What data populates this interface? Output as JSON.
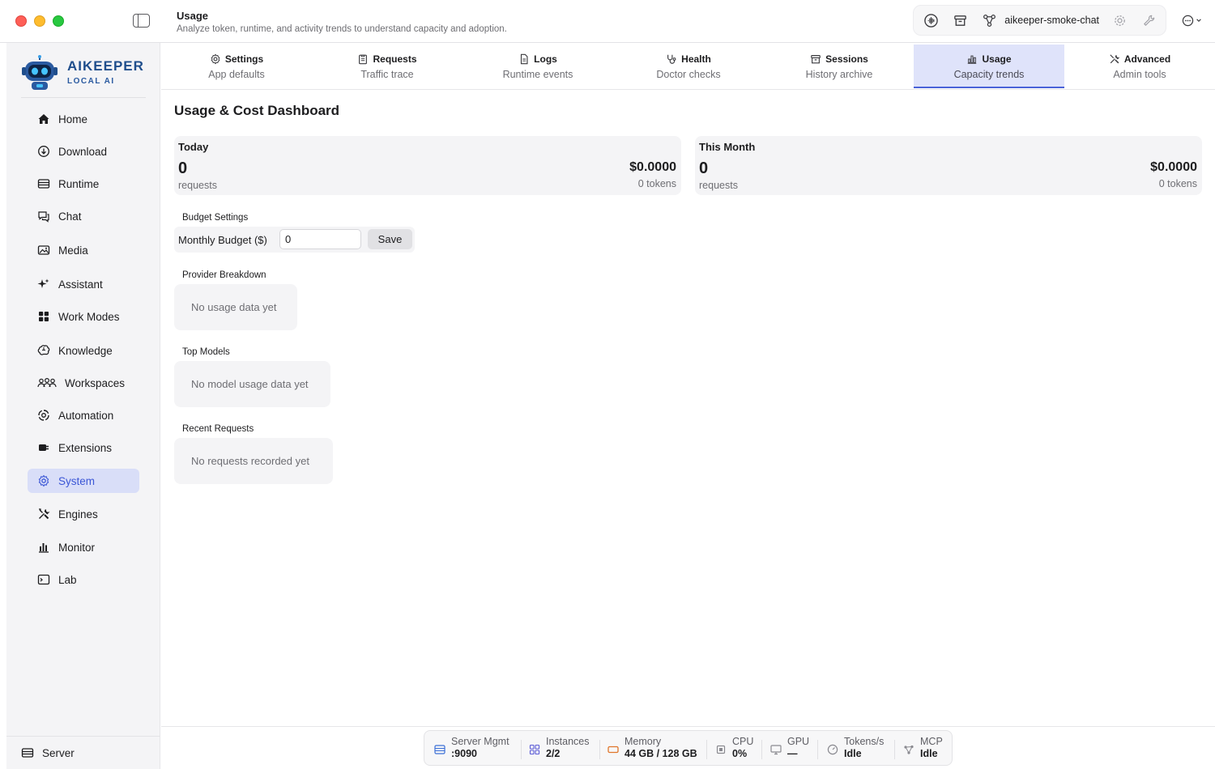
{
  "header": {
    "title": "Usage",
    "subtitle": "Analyze token, runtime, and activity trends to understand capacity and adoption.",
    "project_name": "aikeeper-smoke-chat"
  },
  "brand": {
    "name": "AIKEEPER",
    "tagline": "LOCAL AI"
  },
  "sidebar": {
    "items": [
      {
        "label": "Home",
        "icon": "home-icon"
      },
      {
        "label": "Download",
        "icon": "download-icon"
      },
      {
        "label": "Runtime",
        "icon": "runtime-icon"
      },
      {
        "label": "Chat",
        "icon": "chat-icon"
      },
      {
        "label": "Media",
        "icon": "media-icon"
      },
      {
        "label": "Assistant",
        "icon": "sparkle-icon"
      },
      {
        "label": "Work Modes",
        "icon": "grid-icon"
      },
      {
        "label": "Knowledge",
        "icon": "brain-icon"
      },
      {
        "label": "Workspaces",
        "icon": "people-icon"
      },
      {
        "label": "Automation",
        "icon": "automation-icon"
      },
      {
        "label": "Extensions",
        "icon": "plug-icon"
      },
      {
        "label": "System",
        "icon": "gear-icon",
        "active": true
      },
      {
        "label": "Engines",
        "icon": "tools-icon"
      },
      {
        "label": "Monitor",
        "icon": "bar-chart-icon"
      },
      {
        "label": "Lab",
        "icon": "terminal-icon"
      }
    ],
    "bottom_label": "Server"
  },
  "tabs": [
    {
      "label": "Settings",
      "sub": "App defaults",
      "icon": "gear-icon"
    },
    {
      "label": "Requests",
      "sub": "Traffic trace",
      "icon": "clipboard-icon"
    },
    {
      "label": "Logs",
      "sub": "Runtime events",
      "icon": "document-icon"
    },
    {
      "label": "Health",
      "sub": "Doctor checks",
      "icon": "stethoscope-icon"
    },
    {
      "label": "Sessions",
      "sub": "History archive",
      "icon": "archive-icon"
    },
    {
      "label": "Usage",
      "sub": "Capacity trends",
      "icon": "chart-icon",
      "active": true
    },
    {
      "label": "Advanced",
      "sub": "Admin tools",
      "icon": "tools-icon"
    }
  ],
  "dashboard": {
    "title": "Usage & Cost Dashboard",
    "today": {
      "label": "Today",
      "count": "0",
      "count_label": "requests",
      "cost": "$0.0000",
      "tokens": "0 tokens"
    },
    "month": {
      "label": "This Month",
      "count": "0",
      "count_label": "requests",
      "cost": "$0.0000",
      "tokens": "0 tokens"
    },
    "budget": {
      "section": "Budget Settings",
      "label": "Monthly Budget ($)",
      "value": "0",
      "save_label": "Save"
    },
    "providers": {
      "section": "Provider Breakdown",
      "empty": "No usage data yet"
    },
    "models": {
      "section": "Top Models",
      "empty": "No model usage data yet"
    },
    "recent": {
      "section": "Recent Requests",
      "empty": "No requests recorded yet"
    }
  },
  "statusbar": {
    "server": {
      "label": "Server Mgmt",
      "value": ":9090"
    },
    "instances": {
      "label": "Instances",
      "value": "2/2"
    },
    "memory": {
      "label": "Memory",
      "value": "44 GB / 128 GB"
    },
    "cpu": {
      "label": "CPU",
      "value": "0%"
    },
    "gpu": {
      "label": "GPU",
      "value": "—"
    },
    "tokens": {
      "label": "Tokens/s",
      "value": "Idle"
    },
    "mcp": {
      "label": "MCP",
      "value": "Idle"
    }
  },
  "colors": {
    "accent": "#3b56d6",
    "active_bg": "#d9def8",
    "brand": "#1f4e8c"
  }
}
